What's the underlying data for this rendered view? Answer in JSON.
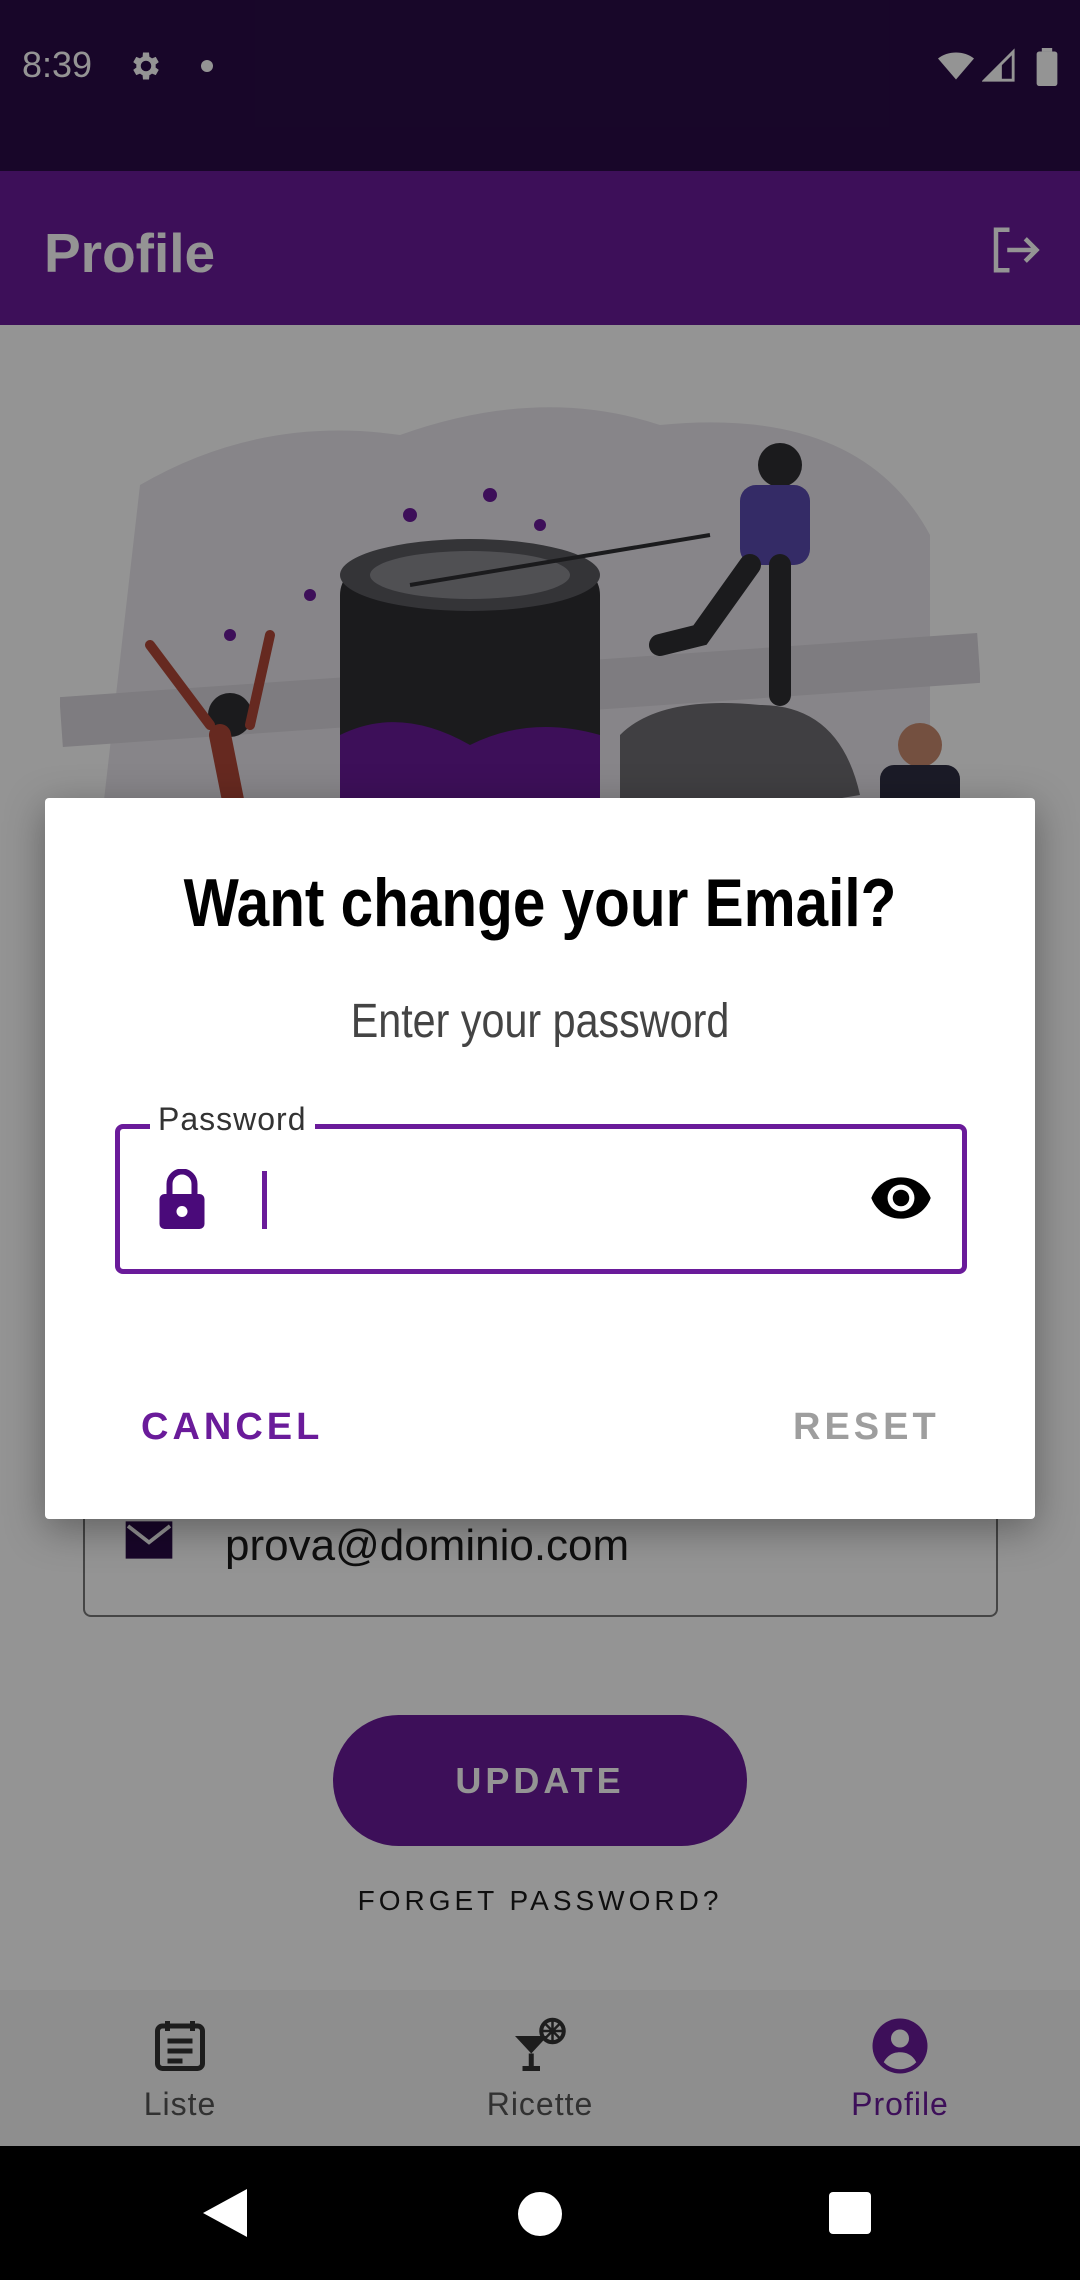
{
  "status_bar": {
    "time": "8:39",
    "icons": [
      "gear-icon",
      "notification-dot-icon",
      "wifi-icon",
      "signal-icon",
      "battery-icon"
    ]
  },
  "app_bar": {
    "title": "Profile",
    "action_icon": "logout-icon"
  },
  "profile": {
    "email_icon": "email-icon",
    "email_value": "prova@dominio.com",
    "update_label": "UPDATE",
    "forget_label": "FORGET PASSWORD?"
  },
  "bottom_nav": {
    "items": [
      {
        "label": "Liste",
        "icon": "list-icon",
        "active": false
      },
      {
        "label": "Ricette",
        "icon": "cocktail-icon",
        "active": false
      },
      {
        "label": "Profile",
        "icon": "account-circle-icon",
        "active": true
      }
    ]
  },
  "dialog": {
    "title": "Want change your Email?",
    "subtitle": "Enter your password",
    "password_label": "Password",
    "password_value": "",
    "cancel_label": "CANCEL",
    "reset_label": "RESET"
  },
  "colors": {
    "primary": "#6a1b9a",
    "status_bar": "#2a0c47",
    "disabled": "#9e9e9e"
  }
}
